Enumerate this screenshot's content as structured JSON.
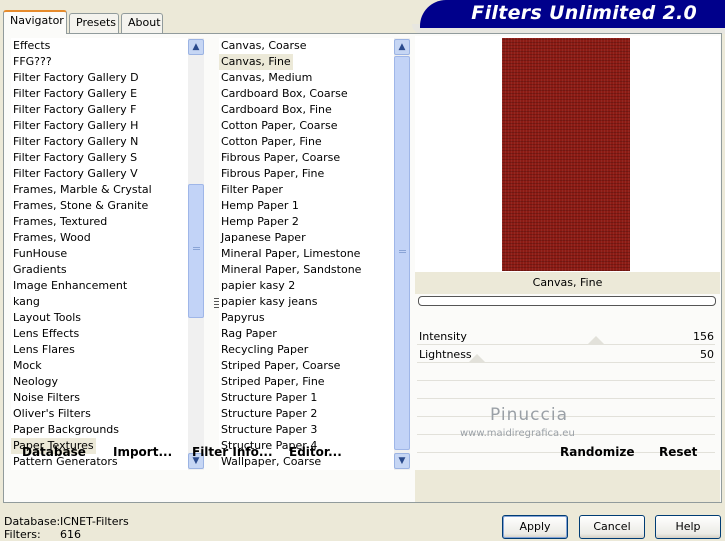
{
  "app": {
    "title": "Filters Unlimited 2.0"
  },
  "tabs": [
    {
      "label": "Navigator",
      "active": true
    },
    {
      "label": "Presets"
    },
    {
      "label": "About"
    }
  ],
  "categories": {
    "selected": "Paper Textures",
    "items": [
      "Effects",
      "FFG???",
      "Filter Factory Gallery D",
      "Filter Factory Gallery E",
      "Filter Factory Gallery F",
      "Filter Factory Gallery H",
      "Filter Factory Gallery N",
      "Filter Factory Gallery S",
      "Filter Factory Gallery V",
      "Frames, Marble & Crystal",
      "Frames, Stone & Granite",
      "Frames, Textured",
      "Frames, Wood",
      "FunHouse",
      "Gradients",
      "Image Enhancement",
      "kang",
      "Layout Tools",
      "Lens Effects",
      "Lens Flares",
      "Mock",
      "Neology",
      "Noise Filters",
      "Oliver's Filters",
      "Paper Backgrounds",
      "Paper Textures",
      "Pattern Generators"
    ]
  },
  "filters": {
    "selected": "Canvas, Fine",
    "items": [
      "Canvas, Coarse",
      "Canvas, Fine",
      "Canvas, Medium",
      "Cardboard Box, Coarse",
      "Cardboard Box, Fine",
      "Cotton Paper, Coarse",
      "Cotton Paper, Fine",
      "Fibrous Paper, Coarse",
      "Fibrous Paper, Fine",
      "Filter Paper",
      "Hemp Paper 1",
      "Hemp Paper 2",
      "Japanese Paper",
      "Mineral Paper, Limestone",
      "Mineral Paper, Sandstone",
      "papier kasy 2",
      "papier kasy jeans",
      "Papyrus",
      "Rag Paper",
      "Recycling Paper",
      "Striped Paper, Coarse",
      "Striped Paper, Fine",
      "Structure Paper 1",
      "Structure Paper 2",
      "Structure Paper 3",
      "Structure Paper 4",
      "Wallpaper, Coarse"
    ]
  },
  "panel_buttons": {
    "database": "Database",
    "import": "Import...",
    "filter_info": "Filter Info...",
    "editor": "Editor...",
    "randomize": "Randomize",
    "reset": "Reset"
  },
  "preview": {
    "filter_name": "Canvas, Fine",
    "texture_color": "#8c1b14"
  },
  "controls": [
    {
      "label": "Intensity",
      "value": "156",
      "fraction": 0.61
    },
    {
      "label": "Lightness",
      "value": "50",
      "fraction": 0.2
    }
  ],
  "watermark": {
    "name": "Pinuccia",
    "url": "www.maidiregrafica.eu"
  },
  "footer": {
    "database_label": "Database:",
    "database_value": "ICNET-Filters",
    "filters_label": "Filters:",
    "filters_value": "616"
  },
  "dialog_buttons": {
    "apply": "Apply",
    "cancel": "Cancel",
    "help": "Help"
  },
  "colors": {
    "banner": "#00008b",
    "tab_accent": "#e68b2c"
  }
}
